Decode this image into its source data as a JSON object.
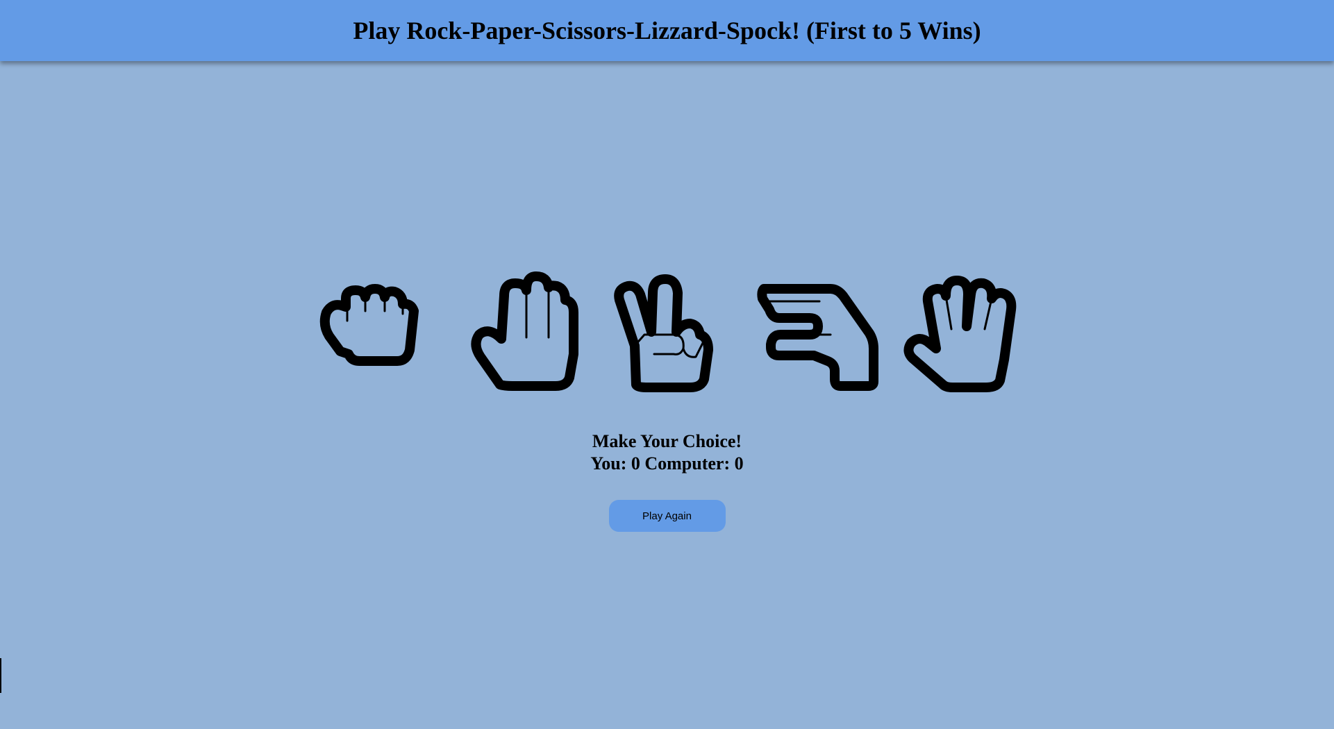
{
  "header": {
    "title": "Play Rock-Paper-Scissors-Lizzard-Spock! (First to 5 Wins)"
  },
  "choices": [
    {
      "id": "rock",
      "icon": "rock-hand-icon"
    },
    {
      "id": "paper",
      "icon": "paper-hand-icon"
    },
    {
      "id": "scissors",
      "icon": "scissors-hand-icon"
    },
    {
      "id": "lizard",
      "icon": "lizard-hand-icon"
    },
    {
      "id": "spock",
      "icon": "spock-hand-icon"
    }
  ],
  "status": {
    "message": "Make Your Choice!",
    "score": "You: 0 Computer: 0"
  },
  "controls": {
    "play_again_label": "Play Again"
  },
  "colors": {
    "background": "#93b3d8",
    "header": "#639be6",
    "button": "#639be6"
  }
}
